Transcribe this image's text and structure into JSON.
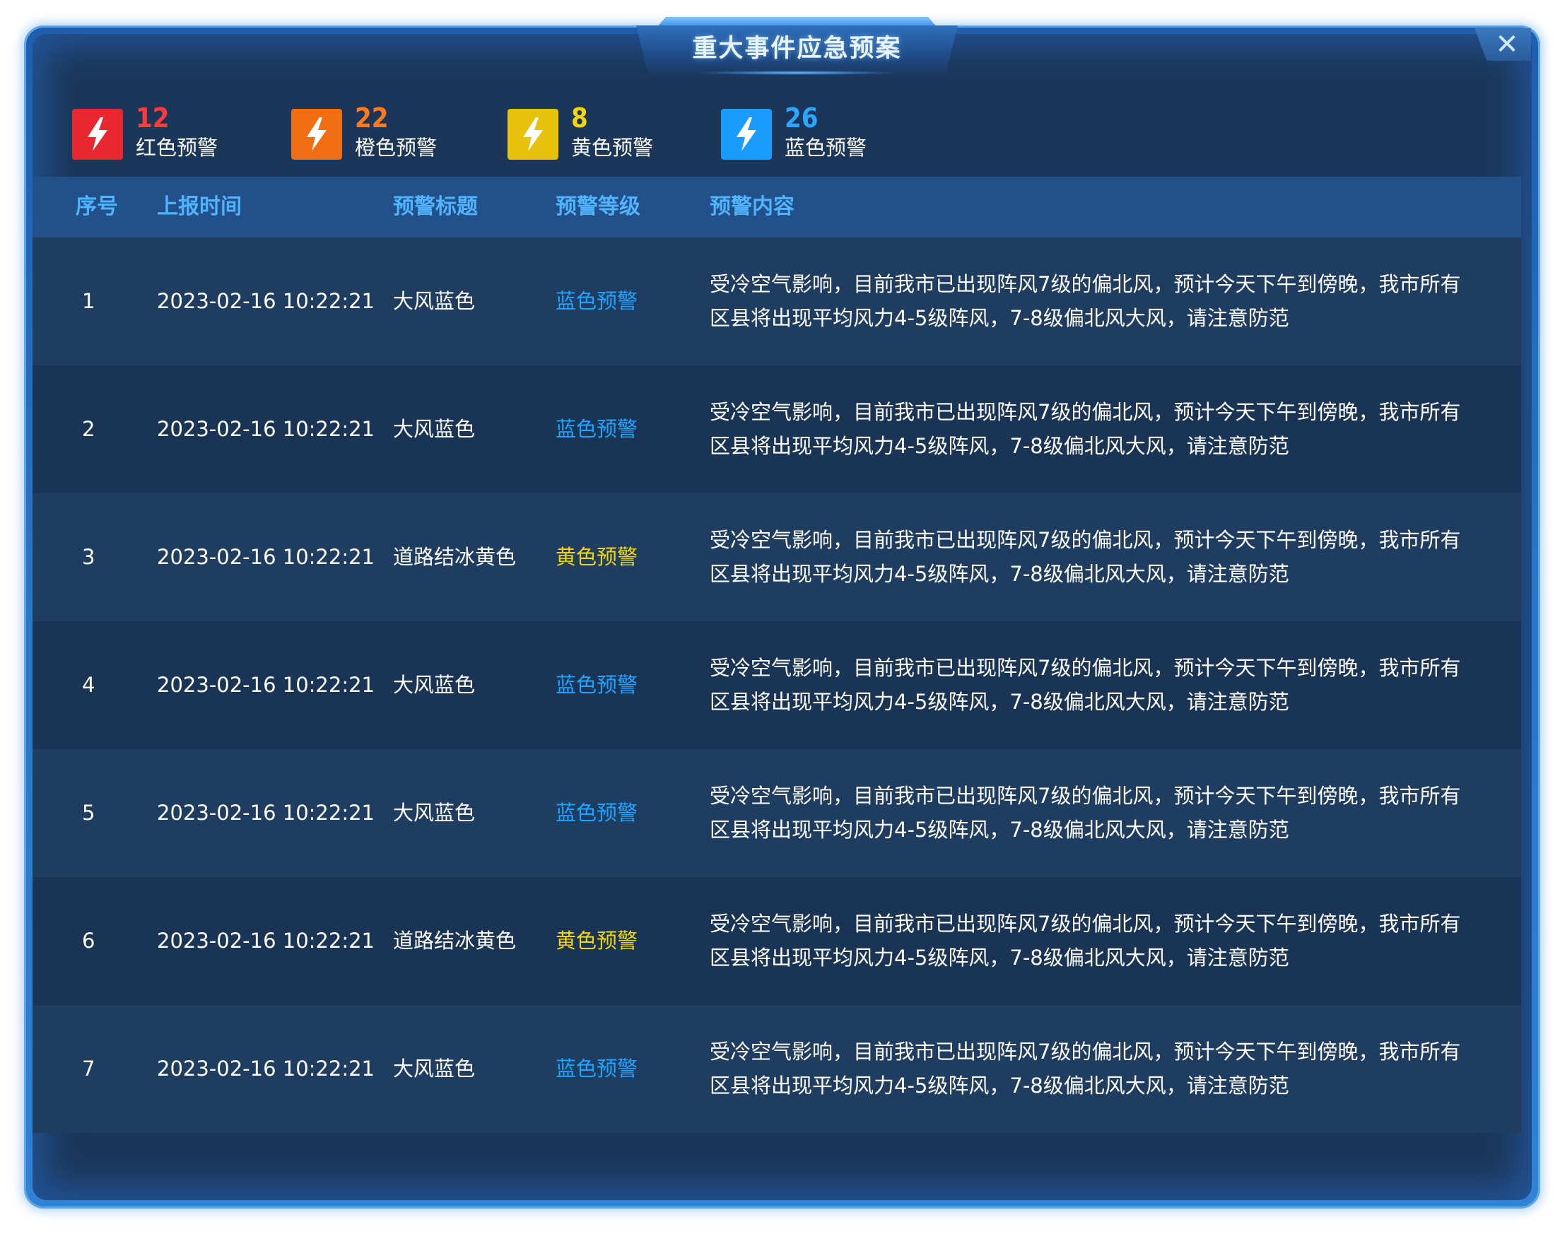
{
  "dialog": {
    "title": "重大事件应急预案",
    "close_glyph": "✕"
  },
  "stats": [
    {
      "count": "12",
      "label": "红色预警",
      "color": "#e8272e",
      "text_color": "#ff3b3b",
      "icon": "lightning-icon"
    },
    {
      "count": "22",
      "label": "橙色预警",
      "color": "#f26d12",
      "text_color": "#ff7a1e",
      "icon": "lightning-icon"
    },
    {
      "count": "8",
      "label": "黄色预警",
      "color": "#e7c10a",
      "text_color": "#f1d50e",
      "icon": "lightning-icon"
    },
    {
      "count": "26",
      "label": "蓝色预警",
      "color": "#1a9bff",
      "text_color": "#2aa6ff",
      "icon": "lightning-icon"
    }
  ],
  "table": {
    "headers": [
      "序号",
      "上报时间",
      "预警标题",
      "预警等级",
      "预警内容"
    ],
    "rows": [
      {
        "id": "1",
        "time": "2023-02-16  10:22:21",
        "title": "大风蓝色",
        "level": "蓝色预警",
        "level_color": "blue",
        "content": "受冷空气影响，目前我市已出现阵风7级的偏北风，预计今天下午到傍晚，我市所有区县将出现平均风力4-5级阵风，7-8级偏北风大风，请注意防范"
      },
      {
        "id": "2",
        "time": "2023-02-16  10:22:21",
        "title": "大风蓝色",
        "level": "蓝色预警",
        "level_color": "blue",
        "content": "受冷空气影响，目前我市已出现阵风7级的偏北风，预计今天下午到傍晚，我市所有区县将出现平均风力4-5级阵风，7-8级偏北风大风，请注意防范"
      },
      {
        "id": "3",
        "time": "2023-02-16  10:22:21",
        "title": "道路结冰黄色",
        "level": "黄色预警",
        "level_color": "yellow",
        "content": "受冷空气影响，目前我市已出现阵风7级的偏北风，预计今天下午到傍晚，我市所有区县将出现平均风力4-5级阵风，7-8级偏北风大风，请注意防范"
      },
      {
        "id": "4",
        "time": "2023-02-16  10:22:21",
        "title": "大风蓝色",
        "level": "蓝色预警",
        "level_color": "blue",
        "content": "受冷空气影响，目前我市已出现阵风7级的偏北风，预计今天下午到傍晚，我市所有区县将出现平均风力4-5级阵风，7-8级偏北风大风，请注意防范"
      },
      {
        "id": "5",
        "time": "2023-02-16  10:22:21",
        "title": "大风蓝色",
        "level": "蓝色预警",
        "level_color": "blue",
        "content": "受冷空气影响，目前我市已出现阵风7级的偏北风，预计今天下午到傍晚，我市所有区县将出现平均风力4-5级阵风，7-8级偏北风大风，请注意防范"
      },
      {
        "id": "6",
        "time": "2023-02-16  10:22:21",
        "title": "道路结冰黄色",
        "level": "黄色预警",
        "level_color": "yellow",
        "content": "受冷空气影响，目前我市已出现阵风7级的偏北风，预计今天下午到傍晚，我市所有区县将出现平均风力4-5级阵风，7-8级偏北风大风，请注意防范"
      },
      {
        "id": "7",
        "time": "2023-02-16  10:22:21",
        "title": "大风蓝色",
        "level": "蓝色预警",
        "level_color": "blue",
        "content": "受冷空气影响，目前我市已出现阵风7级的偏北风，预计今天下午到傍晚，我市所有区县将出现平均风力4-5级阵风，7-8级偏北风大风，请注意防范"
      }
    ]
  }
}
